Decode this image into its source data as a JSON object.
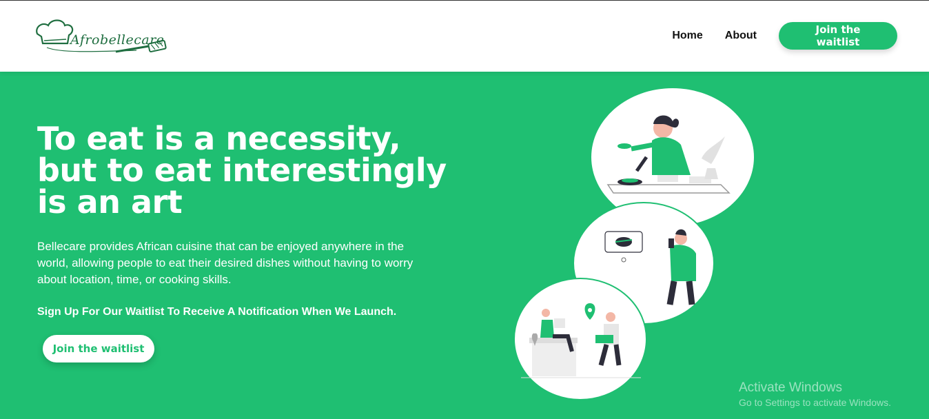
{
  "brand": {
    "name": "Afrobellecare",
    "color": "#1fbf72",
    "logo_color": "#1f6e40"
  },
  "nav": {
    "links": [
      "Home",
      "About"
    ],
    "cta": "Join the waitlist"
  },
  "hero": {
    "headline": [
      "To eat is a necessity,",
      "but to eat interestingly",
      "is an art"
    ],
    "description": "Bellecare provides African cuisine that can be enjoyed anywhere in the world, allowing people to eat their desired dishes without having to worry about location, time, or cooking skills.",
    "signup_text": "Sign Up For Our Waitlist To Receive A Notification When We Launch.",
    "cta": "Join the waitlist"
  },
  "illustrations": {
    "items": [
      "woman-eating-illustration",
      "man-ordering-food-illustration",
      "food-delivery-illustration"
    ]
  },
  "watermark": {
    "title": "Activate Windows",
    "subtitle": "Go to Settings to activate Windows."
  }
}
